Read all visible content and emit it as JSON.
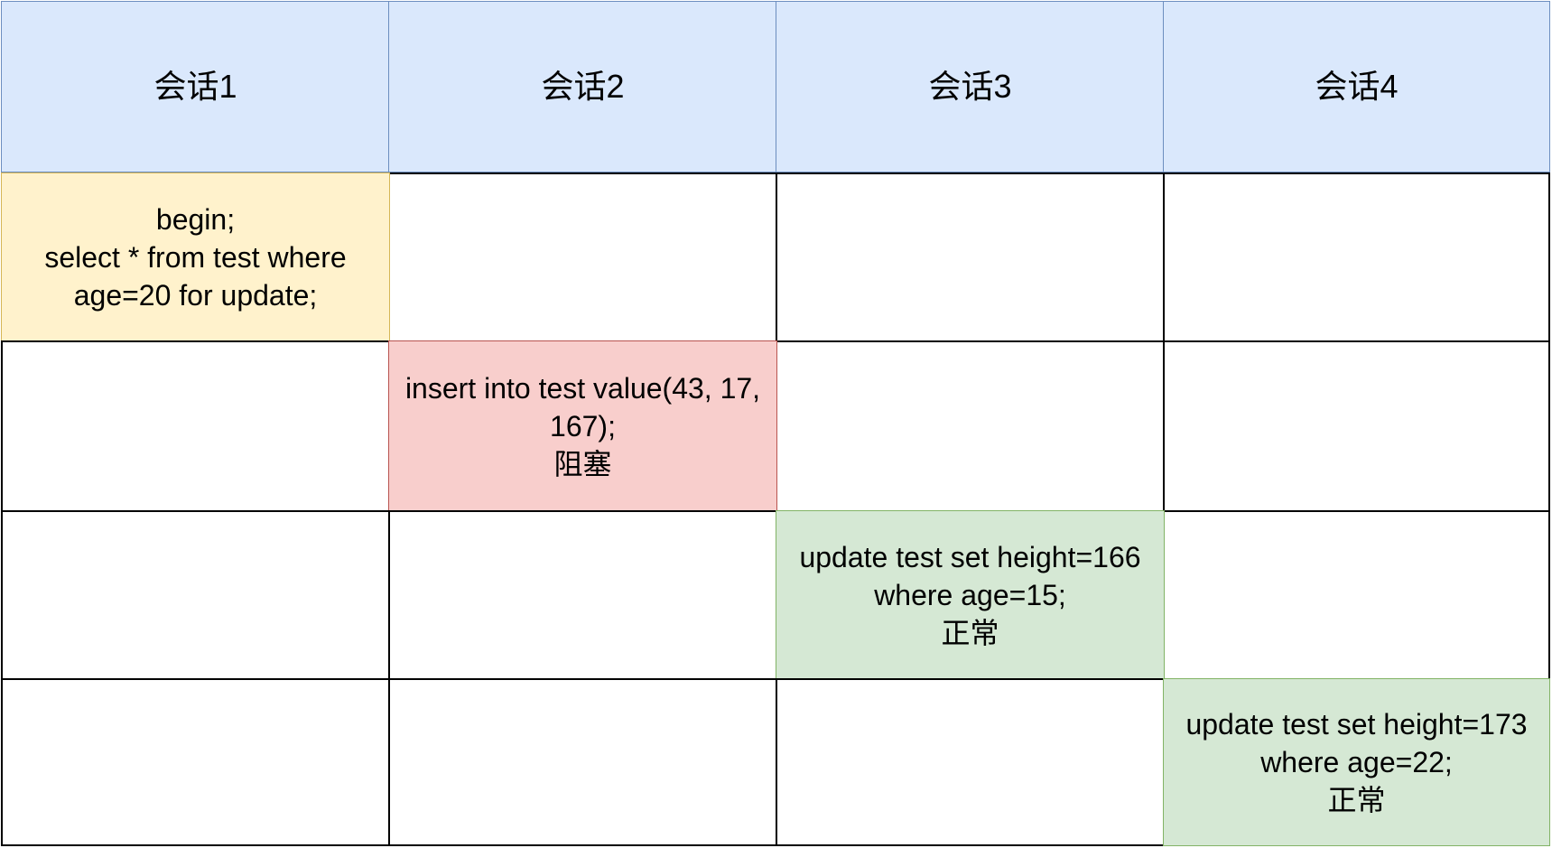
{
  "headers": [
    "会话1",
    "会话2",
    "会话3",
    "会话4"
  ],
  "steps": {
    "session1": "begin;\nselect * from test where age=20 for update;",
    "session2": "insert into test value(43, 17, 167);\n阻塞",
    "session3": "update test set height=166 where age=15;\n正常",
    "session4": "update test set height=173 where age=22;\n正常"
  },
  "colors": {
    "header": "#dae8fc",
    "step1": "#fff2cc",
    "step2": "#f8cecc",
    "step3": "#d5e8d4",
    "step4": "#d5e8d4"
  }
}
